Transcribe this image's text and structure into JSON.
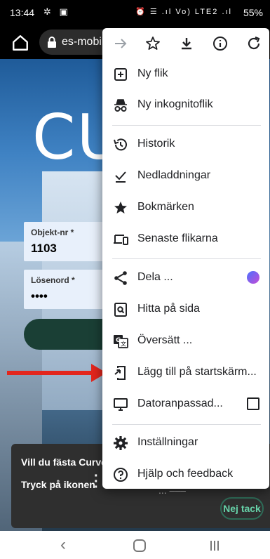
{
  "status_bar": {
    "time": "13:44",
    "left_icons": "✲ ▣",
    "right_icons": "⏰ ☰ .ıl Vo) LTE2 .ıl",
    "battery": "55%"
  },
  "toolbar": {
    "url": "es-mobile"
  },
  "page": {
    "logo": "CU",
    "object_label": "Objekt-nr *",
    "object_value": "1103",
    "password_label": "Lösenord *",
    "password_value": "••••"
  },
  "banner": {
    "line1": "Vill du fästa Curves",
    "line2": "Tryck på ikonen",
    "faded_text": "... –––",
    "dismiss_label": "Nej tack"
  },
  "menu": {
    "items": [
      {
        "label": "Ny flik",
        "icon": "new-tab-icon"
      },
      {
        "label": "Ny inkognitoflik",
        "icon": "incognito-icon"
      },
      {
        "label": "Historik",
        "icon": "history-icon"
      },
      {
        "label": "Nedladdningar",
        "icon": "downloads-icon"
      },
      {
        "label": "Bokmärken",
        "icon": "star-icon"
      },
      {
        "label": "Senaste flikarna",
        "icon": "devices-icon"
      },
      {
        "label": "Dela ...",
        "icon": "share-icon"
      },
      {
        "label": "Hitta på sida",
        "icon": "find-icon"
      },
      {
        "label": "Översätt ...",
        "icon": "translate-icon"
      },
      {
        "label": "Lägg till på startskärm...",
        "icon": "add-to-home-icon"
      },
      {
        "label": "Datoranpassad...",
        "icon": "desktop-icon"
      },
      {
        "label": "Inställningar",
        "icon": "settings-icon"
      },
      {
        "label": "Hjälp och feedback",
        "icon": "help-icon"
      }
    ]
  },
  "colors": {
    "arrow": "#e3261c",
    "login_button": "#1a3f35",
    "accent_green": "#66d1a8"
  }
}
